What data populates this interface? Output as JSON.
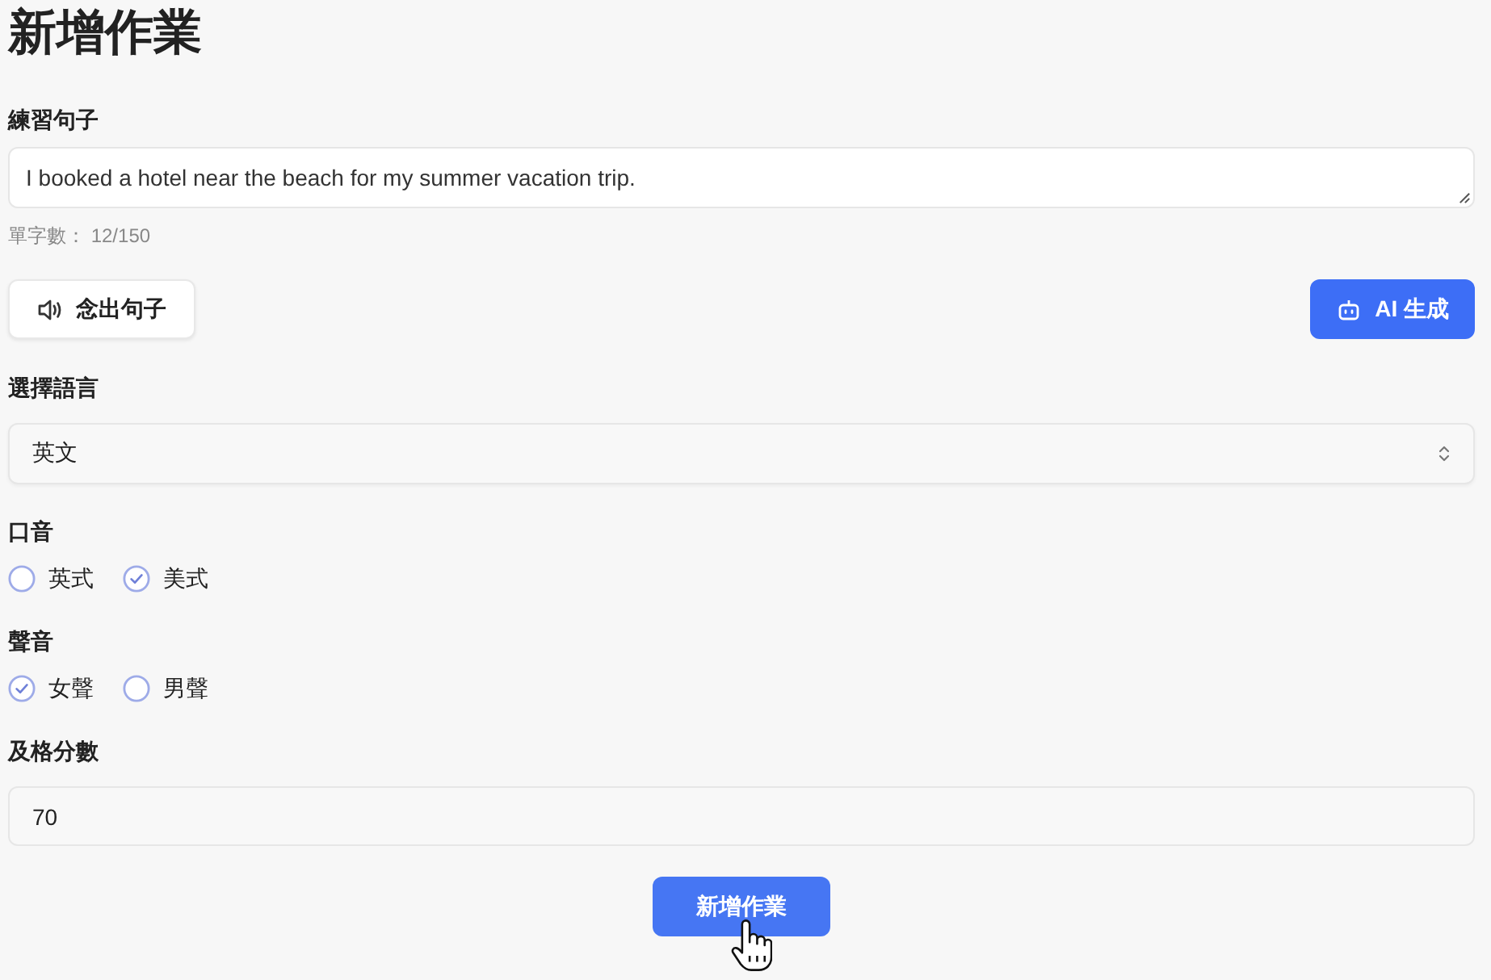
{
  "page": {
    "title": "新增作業"
  },
  "sentence": {
    "label": "練習句子",
    "value": "I booked a hotel near the beach for my summer vacation trip.",
    "word_count": "單字數： 12/150"
  },
  "actions": [
    {
      "kind": "speak",
      "label": "念出句子"
    },
    {
      "kind": "generate",
      "label": "AI 生成"
    }
  ],
  "language": {
    "label": "選擇語言",
    "value": "英文"
  },
  "radio_groups": [
    {
      "label": "口音",
      "options": [
        {
          "label": "英式",
          "selected": false
        },
        {
          "label": "美式",
          "selected": true
        }
      ]
    },
    {
      "label": "聲音",
      "options": [
        {
          "label": "女聲",
          "selected": true
        },
        {
          "label": "男聲",
          "selected": false
        }
      ]
    }
  ],
  "passing_score": {
    "label": "及格分數",
    "value": "70"
  },
  "submit": {
    "label": "新增作業"
  }
}
